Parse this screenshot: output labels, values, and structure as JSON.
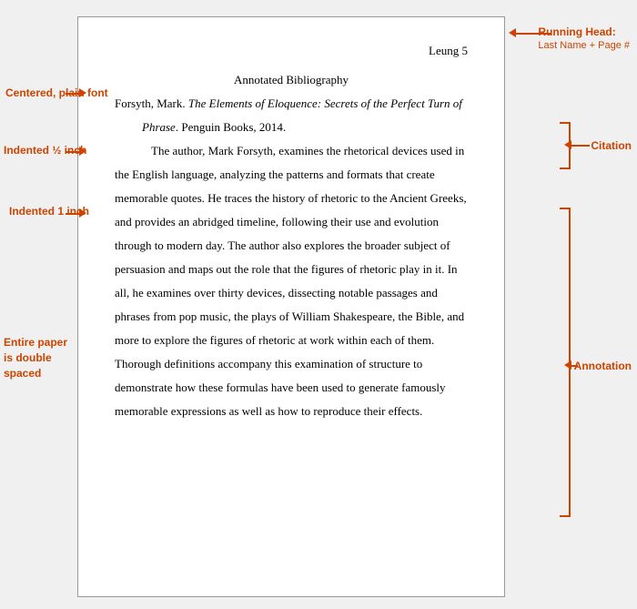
{
  "labels": {
    "running_head_title": "Running Head:",
    "running_head_desc": "Last Name + Page #",
    "centered_plain": "Centered, plain font",
    "indented_half": "Indented ½ inch",
    "indented_one": "Indented 1 inch",
    "double_spaced": "Entire paper is double spaced",
    "citation_label": "Citation",
    "annotation_label": "Annotation"
  },
  "content": {
    "running_head": "Leung 5",
    "bib_title": "Annotated Bibliography",
    "citation_normal_start": "Forsyth, Mark. ",
    "citation_italic": "The Elements of Eloquence: Secrets of the Perfect Turn of Phrase",
    "citation_normal_end": ". Penguin Books, 2014.",
    "annotation_text": "The author, Mark Forsyth, examines the rhetorical devices used in the English language, analyzing the patterns and formats that create memorable quotes. He traces the history of rhetoric to the Ancient Greeks, and provides an abridged timeline, following their use and evolution through to modern day. The author also explores the broader subject of persuasion and maps out the role that the figures of rhetoric play in it. In all, he examines over thirty devices, dissecting notable passages and phrases from pop music, the plays of William Shakespeare, the Bible, and more to explore the figures of rhetoric at work within each of them. Thorough definitions accompany this examination of structure to demonstrate how these formulas have been used to generate famously memorable expressions as well as how to reproduce their effects."
  }
}
